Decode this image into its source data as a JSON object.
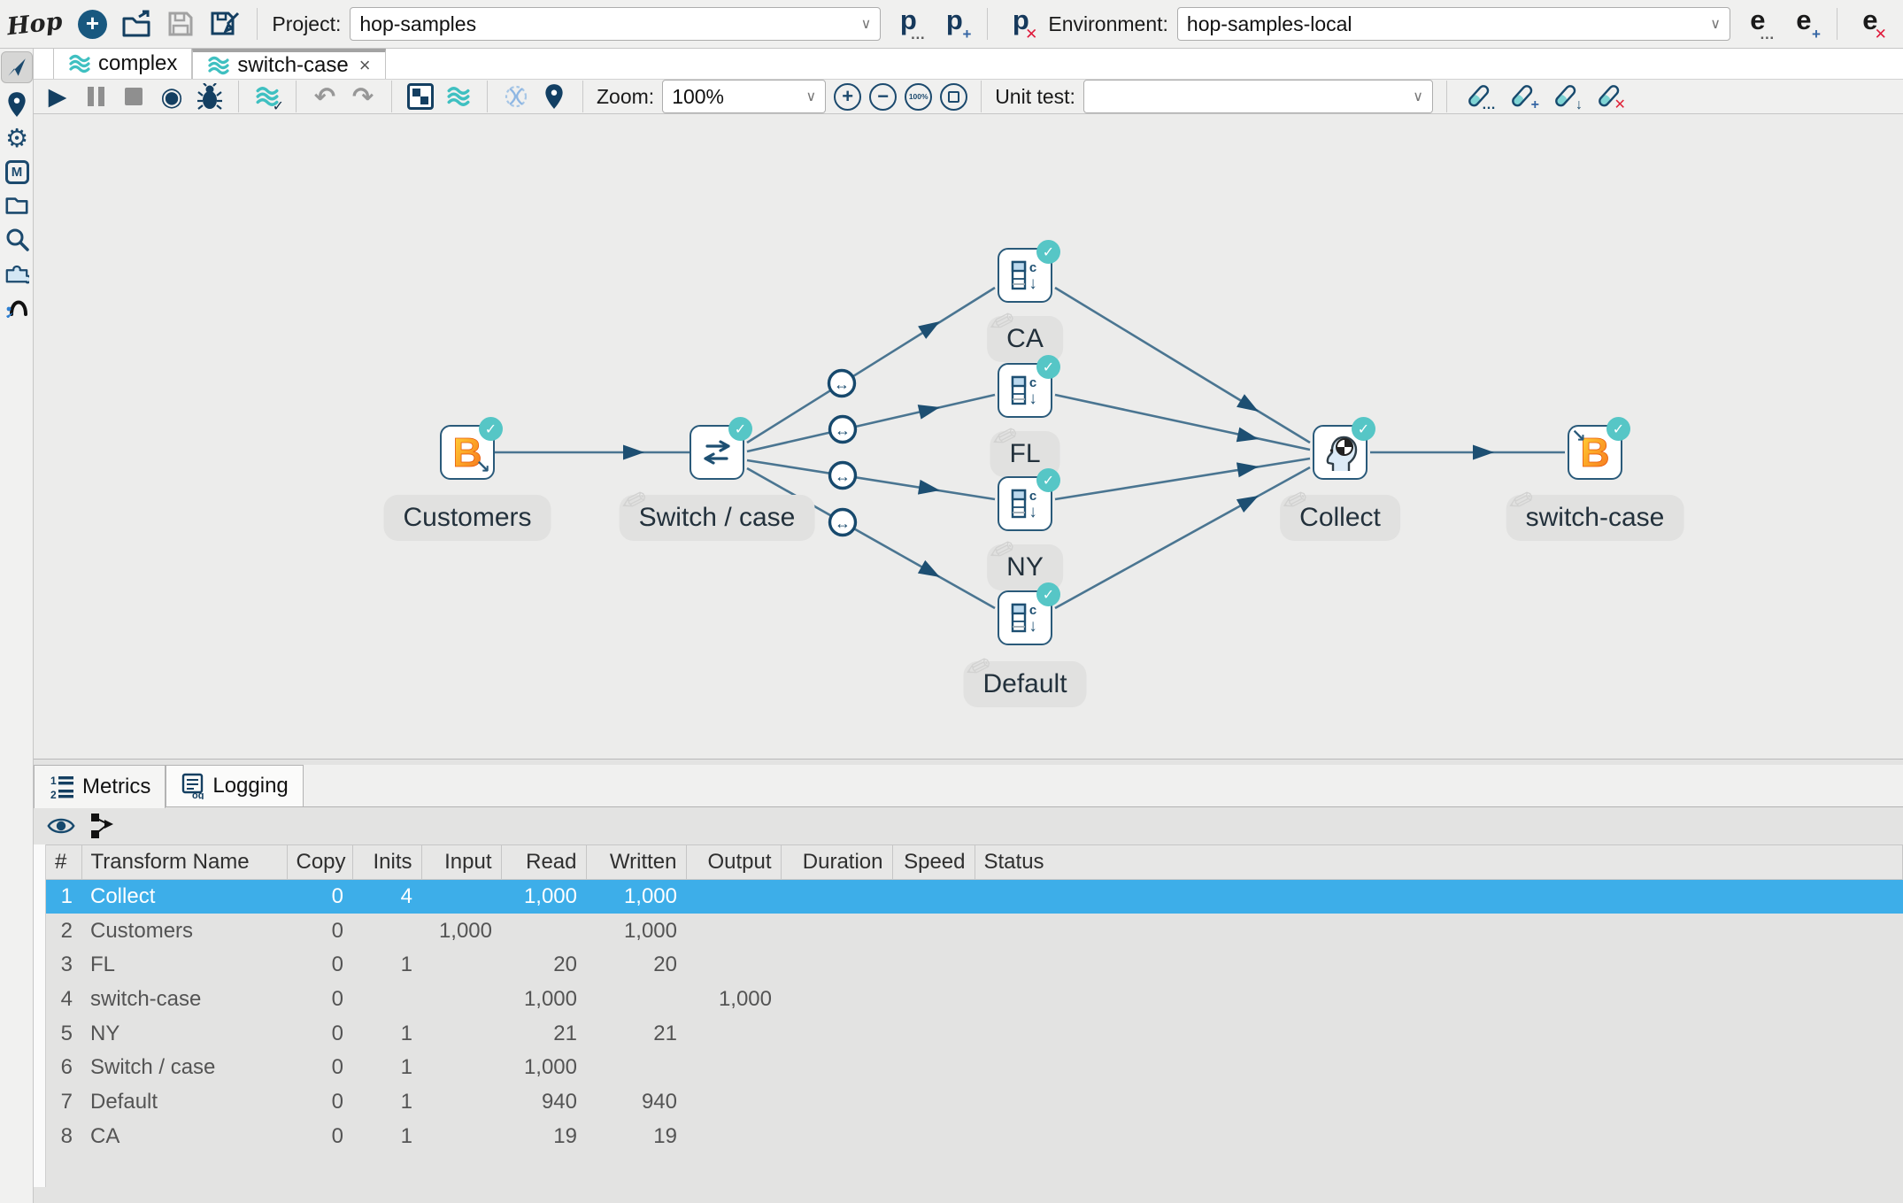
{
  "header": {
    "logo_text": "Hop",
    "project_label": "Project:",
    "project_value": "hop-samples",
    "environment_label": "Environment:",
    "environment_value": "hop-samples-local",
    "icon_letters": {
      "project": "p",
      "environment": "e"
    }
  },
  "tabs": {
    "items": [
      {
        "label": "complex"
      },
      {
        "label": "switch-case"
      }
    ],
    "active": "switch-case",
    "close_glyph": "×"
  },
  "toolbar": {
    "zoom_label": "Zoom:",
    "zoom_value": "100%",
    "zoom_reset_label": "100%",
    "unit_test_label": "Unit test:",
    "unit_test_value": ""
  },
  "glyphs": {
    "plus": "+",
    "minus": "−",
    "ellipsis": "…",
    "cross": "✕",
    "down_arrow": "↓",
    "undo": "↶",
    "redo": "↷",
    "dropdown": "∨",
    "check": "✓",
    "double_arrow": "↔",
    "beam_letter": "B",
    "beam_arrow": "↘",
    "const_letter": "c",
    "pencil": "✎",
    "metadata_letter": "M",
    "list_one": "1",
    "list_two": "2",
    "log_label": "og",
    "play": "▶",
    "preview": "◉"
  },
  "sidebar": {
    "items": [
      "navigate",
      "location",
      "settings",
      "metadata",
      "files",
      "search",
      "plugins",
      "hop"
    ]
  },
  "pipeline": {
    "nodes": [
      {
        "label": "Customers",
        "type": "beam-input"
      },
      {
        "label": "Switch / case",
        "type": "switch-case"
      },
      {
        "label": "CA",
        "type": "add-constants"
      },
      {
        "label": "FL",
        "type": "add-constants"
      },
      {
        "label": "NY",
        "type": "add-constants"
      },
      {
        "label": "Default",
        "type": "add-constants"
      },
      {
        "label": "Collect",
        "type": "collect"
      },
      {
        "label": "switch-case",
        "type": "beam-output"
      }
    ]
  },
  "metrics": {
    "tabs": [
      {
        "label": "Metrics"
      },
      {
        "label": "Logging"
      }
    ],
    "columns": [
      "#",
      "Transform Name",
      "Copy",
      "Inits",
      "Input",
      "Read",
      "Written",
      "Output",
      "Duration",
      "Speed",
      "Status"
    ],
    "rows": [
      [
        "1",
        "Collect",
        "0",
        "4",
        "",
        "1,000",
        "1,000",
        "",
        "",
        "",
        ""
      ],
      [
        "2",
        "Customers",
        "0",
        "",
        "1,000",
        "",
        "1,000",
        "",
        "",
        "",
        ""
      ],
      [
        "3",
        "FL",
        "0",
        "1",
        "",
        "20",
        "20",
        "",
        "",
        "",
        ""
      ],
      [
        "4",
        "switch-case",
        "0",
        "",
        "",
        "1,000",
        "",
        "1,000",
        "",
        "",
        ""
      ],
      [
        "5",
        "NY",
        "0",
        "1",
        "",
        "21",
        "21",
        "",
        "",
        "",
        ""
      ],
      [
        "6",
        "Switch / case",
        "0",
        "1",
        "",
        "1,000",
        "",
        "",
        "",
        "",
        ""
      ],
      [
        "7",
        "Default",
        "0",
        "1",
        "",
        "940",
        "940",
        "",
        "",
        "",
        ""
      ],
      [
        "8",
        "CA",
        "0",
        "1",
        "",
        "19",
        "19",
        "",
        "",
        "",
        ""
      ]
    ],
    "selected_row": 0
  },
  "colors": {
    "accent_selection": "#3daee9",
    "icon_navy": "#17496d",
    "teal": "#3fc0c1",
    "check_badge": "#56c6c6",
    "hop_line": "#4a7591",
    "canvas_bg": "#ececeb"
  }
}
